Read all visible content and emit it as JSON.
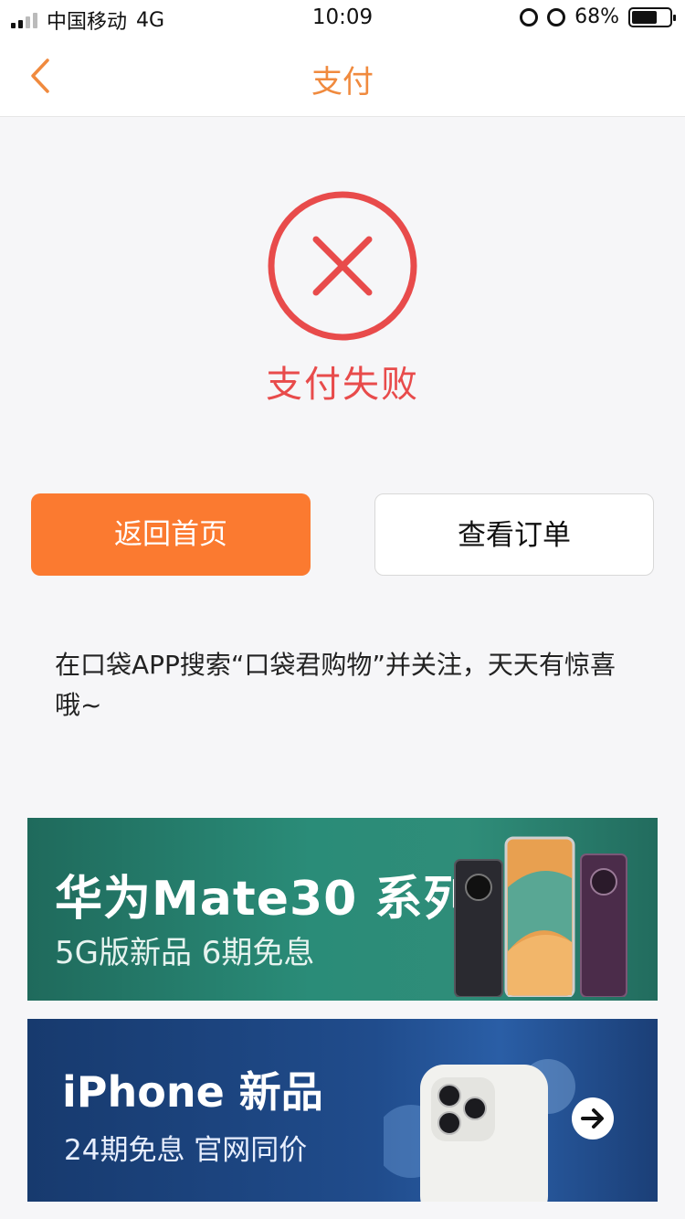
{
  "status_bar": {
    "carrier": "中国移动",
    "network": "4G",
    "time": "10:09",
    "battery": "68%"
  },
  "nav": {
    "title": "支付",
    "back_icon": "chevron-left-icon"
  },
  "result": {
    "status_text": "支付失败",
    "icon": "close-circle-icon",
    "color": "#e84b4b"
  },
  "actions": {
    "home_label": "返回首页",
    "order_label": "查看订单"
  },
  "tip": "在口袋APP搜索“口袋君购物”并关注，天天有惊喜哦~",
  "banners": {
    "mate": {
      "title": "华为Mate30 系列",
      "subtitle": "5G版新品 6期免息"
    },
    "iphone": {
      "title": "iPhone 新品",
      "subtitle": "24期免息 官网同价",
      "arrow_icon": "arrow-right-icon"
    }
  },
  "colors": {
    "accent": "#fb7a30",
    "nav_title": "#f08a3e",
    "error": "#e84b4b"
  }
}
